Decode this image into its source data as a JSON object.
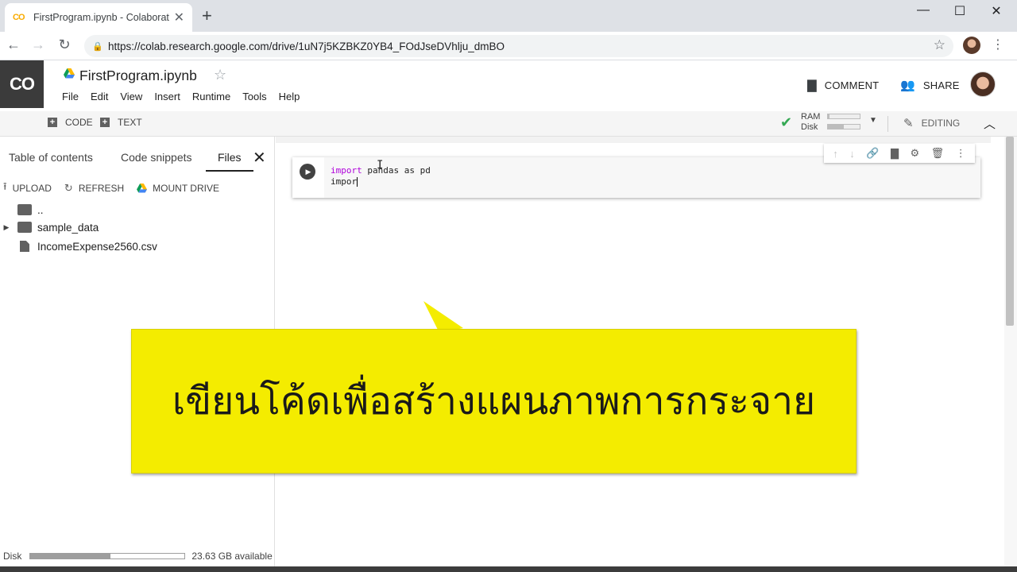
{
  "browser": {
    "tab_title": "FirstProgram.ipynb - Colaboratory",
    "tab_favicon": "CO",
    "url": "https://colab.research.google.com/drive/1uN7j5KZBKZ0YB4_FOdJseDVhlju_dmBO",
    "icons": {
      "back": "arrow-left-icon",
      "forward": "arrow-right-icon",
      "reload": "reload-icon",
      "lock": "lock-icon",
      "bookmark": "star-icon",
      "menu": "more-vert-icon",
      "new_tab": "plus-icon",
      "close_tab": "close-icon"
    },
    "window_controls": [
      "minimize",
      "maximize",
      "close"
    ]
  },
  "colab": {
    "logo": "CO",
    "notebook_title": "FirstProgram.ipynb",
    "menu": [
      "File",
      "Edit",
      "View",
      "Insert",
      "Runtime",
      "Tools",
      "Help"
    ],
    "header_actions": {
      "comment": "COMMENT",
      "share": "SHARE"
    },
    "toolbar": {
      "add_code": "+ CODE",
      "add_code_label": "CODE",
      "add_text_label": "TEXT",
      "ram_label": "RAM",
      "disk_label": "Disk",
      "ram_usage": 0.04,
      "disk_usage": 0.5,
      "editing_label": "EDITING"
    }
  },
  "sidebar": {
    "tabs": [
      "Table of contents",
      "Code snippets",
      "Files"
    ],
    "active_tab": "Files",
    "actions": {
      "upload": "UPLOAD",
      "refresh": "REFRESH",
      "mount_drive": "MOUNT DRIVE"
    },
    "files": [
      {
        "name": "..",
        "type": "parent-folder"
      },
      {
        "name": "sample_data",
        "type": "folder"
      },
      {
        "name": "IncomeExpense2560.csv",
        "type": "file"
      }
    ],
    "disk": {
      "label": "Disk",
      "available": "23.63 GB available",
      "usage": 0.52
    }
  },
  "cell": {
    "lines": [
      {
        "keyword": "import",
        "rest": " pandas as pd"
      },
      {
        "keyword": "",
        "rest": "impor"
      }
    ],
    "tools": [
      "arrow-up-icon",
      "arrow-down-icon",
      "link-icon",
      "comment-icon",
      "gear-icon",
      "delete-icon",
      "more-vert-icon"
    ]
  },
  "overlay": {
    "caption": "เขียนโค้ดเพื่อสร้างแผนภาพการกระจาย",
    "background": "#f4ec00"
  }
}
